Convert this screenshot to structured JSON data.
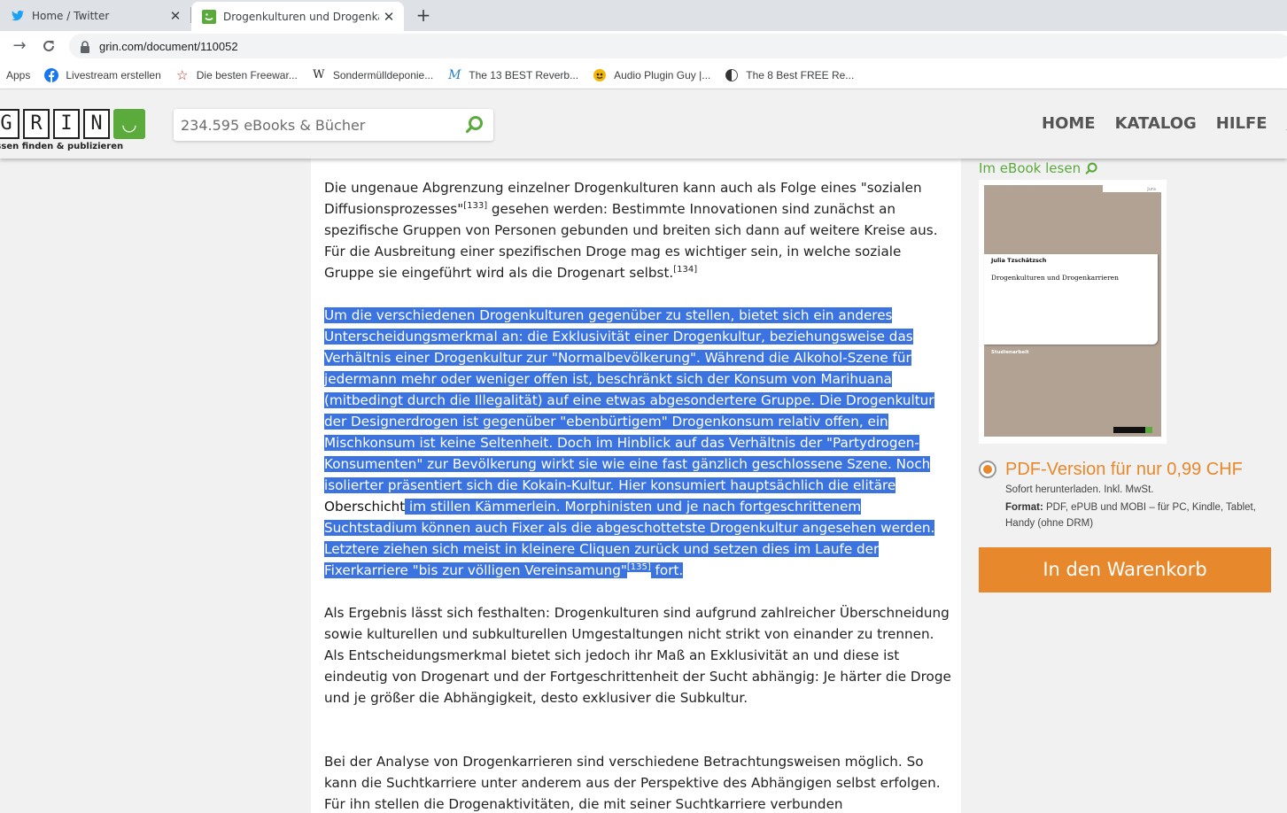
{
  "browser": {
    "tabs": [
      {
        "title": "Home / Twitter",
        "active": false
      },
      {
        "title": "Drogenkulturen und Drogenkarri",
        "active": true
      }
    ],
    "url": "grin.com/document/110052",
    "bookmarks": [
      {
        "label": "Apps",
        "icon": "apps-icon"
      },
      {
        "label": "Livestream erstellen",
        "icon": "facebook-icon"
      },
      {
        "label": "Die besten Freewar...",
        "icon": "star-icon"
      },
      {
        "label": "Sondermülldeponie...",
        "icon": "wikipedia-icon"
      },
      {
        "label": "The 13 BEST Reverb...",
        "icon": "m-logo-icon"
      },
      {
        "label": "Audio Plugin Guy |...",
        "icon": "plugin-guy-icon"
      },
      {
        "label": "The 8 Best FREE Re...",
        "icon": "half-moon-icon"
      }
    ]
  },
  "header": {
    "logo_letters": [
      "G",
      "R",
      "I",
      "N"
    ],
    "logo_smile": "◡",
    "logo_tagline": "issen finden & publizieren",
    "search_placeholder": "234.595 eBooks & Bücher",
    "nav": [
      "HOME",
      "KATALOG",
      "HILFE",
      "EI"
    ]
  },
  "article": {
    "p1": {
      "t1": "Die ungenaue Abgrenzung einzelner Drogenkulturen kann auch als Folge eines \"sozialen Diffusionsprozesses\"",
      "fn1": "[133]",
      "t2": " gesehen werden: Bestimmte Innovationen sind zunächst an spezifische Gruppen von Personen gebunden und breiten sich dann auf weitere Kreise aus. Für die Ausbreitung einer spezifischen Droge mag es wichtiger sein, in welche soziale Gruppe sie eingeführt wird als die Drogenart selbst.",
      "fn2": "[134]"
    },
    "p2": {
      "t1": "Um die verschiedenen Drogenkulturen gegenüber zu stellen, bietet sich ein anderes Unterscheidungsmerkmal an: die Exklusivität einer Drogenkultur, beziehungsweise das Verhältnis einer Drogenkultur zur \"Normalbevölkerung\". Während die Alkohol-Szene für jedermann mehr oder weniger offen ist, beschränkt sich der Konsum von Marihuana (mitbedingt durch die Illegalität) auf eine etwas abgesondertere Gruppe. Die Drogenkultur der Designerdrogen ist gegenüber \"ebenbürtigem\" Drogenkonsum relativ offen, ein Mischkonsum ist keine Seltenheit. Doch im Hinblick auf das Verhältnis der \"Partydrogen-Konsumenten\" zur Bevölkerung wirkt sie wie eine fast gänzlich geschlossene Szene. Noch isolierter präsentiert sich die Kokain-Kultur. Hier konsumiert hauptsächlich die elitäre ",
      "word": "Oberschicht",
      "t2": " im stillen Kämmerlein. Morphinisten und je nach fortgeschrittenem Suchtstadium können auch Fixer als die abgeschottetste Drogenkultur angesehen werden. Letztere ziehen sich meist in kleinere Cliquen zurück und setzen dies im Laufe der Fixerkarriere \"bis zur völligen Vereinsamung\"",
      "fn": "[135]",
      "t3": " fort."
    },
    "p3": "Als Ergebnis lässt sich festhalten: Drogenkulturen sind aufgrund zahlreicher Überschneidung sowie kulturellen und subkulturellen Umgestaltungen nicht strikt von einander zu trennen. Als Entscheidungsmerkmal bietet sich jedoch ihr Maß an Exklusivität an und diese ist eindeutig von Drogenart und der Fortgeschrittenheit der Sucht abhängig: Je härter die Droge und je größer die Abhängigkeit, desto exklusiver die Subkultur.",
    "p4": "Bei der Analyse von Drogenkarrieren sind verschiedene Betrachtungsweisen möglich. So kann die Suchtkarriere unter anderem aus der Perspektive des Abhängigen selbst erfolgen. Für ihn stellen die Drogenaktivitäten, die mit seiner Suchtkarriere verbunden"
  },
  "sidebar": {
    "ebook_link": "Im eBook lesen",
    "cover": {
      "category": "Jura",
      "author": "Julia Tzschätzsch",
      "title": "Drogenkulturen und Drogenkarrieren",
      "type": "Studienarbeit"
    },
    "pdf_label": "PDF-Version für nur 0,99 CHF",
    "pdf_note": "Sofort herunterladen. Inkl. MwSt.",
    "format_label": "Format:",
    "format_value": " PDF, ePUB und MOBI  – für PC, Kindle, Tablet, Handy (ohne DRM)",
    "cart_button": "In den Warenkorb"
  },
  "colors": {
    "grin_green": "#5aaa3c",
    "accent_orange": "#e8882c",
    "selection_blue": "#3b73e0"
  }
}
